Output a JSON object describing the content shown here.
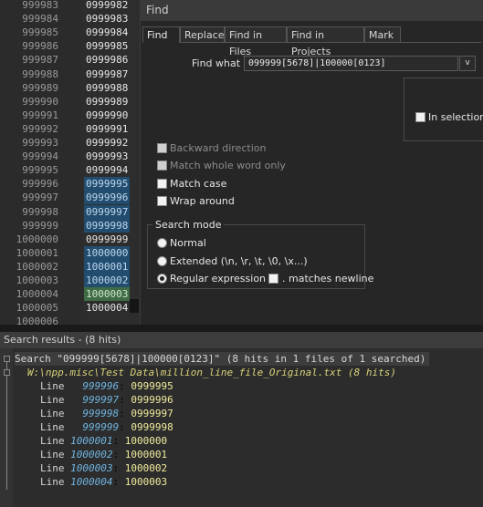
{
  "editor": {
    "line_numbers": [
      "999983",
      "999984",
      "999985",
      "999986",
      "999987",
      "999988",
      "999989",
      "999990",
      "999991",
      "999992",
      "999993",
      "999994",
      "999995",
      "999996",
      "999997",
      "999998",
      "999999",
      "1000000",
      "1000001",
      "1000002",
      "1000003",
      "1000004",
      "1000005",
      "1000006"
    ],
    "line_texts": [
      "0999982",
      "0999983",
      "0999984",
      "0999985",
      "0999986",
      "0999987",
      "0999988",
      "0999989",
      "0999990",
      "0999991",
      "0999992",
      "0999993",
      "0999994",
      "0999995",
      "0999996",
      "0999997",
      "0999998",
      "0999999",
      "1000000",
      "1000001",
      "1000002",
      "1000003",
      "1000004",
      ""
    ]
  },
  "find_dialog": {
    "title": "Find",
    "tabs": [
      "Find",
      "Replace",
      "Find in Files",
      "Find in Projects",
      "Mark"
    ],
    "active_tab": "Find",
    "find_what_label": "Find what :",
    "find_what_value": "099999[5678]|100000[0123]",
    "dropdown_glyph": "v",
    "in_selection_label": "In selection",
    "options": {
      "backward_direction": "Backward direction",
      "match_whole_word": "Match whole word only",
      "match_case": "Match case",
      "wrap_around": "Wrap around"
    },
    "search_mode": {
      "legend": "Search mode",
      "normal": "Normal",
      "extended": "Extended (\\n, \\r, \\t, \\0, \\x...)",
      "regex": "Regular expression",
      "matches_newline": ". matches newline",
      "selected": "regex"
    }
  },
  "results": {
    "header": "Search results - (8 hits)",
    "search_line": "Search \"099999[5678]|100000[0123]\" (8 hits in 1 files of 1 searched)",
    "file_line": "W:\\npp.misc\\Test Data\\million_line_file_Original.txt (8 hits)",
    "hits": [
      {
        "kw": "Line",
        "num": "  999996",
        "val": "0999995"
      },
      {
        "kw": "Line",
        "num": "  999997",
        "val": "0999996"
      },
      {
        "kw": "Line",
        "num": "  999998",
        "val": "0999997"
      },
      {
        "kw": "Line",
        "num": "  999999",
        "val": "0999998"
      },
      {
        "kw": "Line",
        "num": "1000001",
        "val": "1000000"
      },
      {
        "kw": "Line",
        "num": "1000002",
        "val": "1000001"
      },
      {
        "kw": "Line",
        "num": "1000003",
        "val": "1000002"
      },
      {
        "kw": "Line",
        "num": "1000004",
        "val": "1000003"
      }
    ]
  },
  "colors": {
    "hit_highlight": "#234d6e",
    "current_line": "#3f6b45",
    "line_ref": "#6fb3e0",
    "match_text": "#f0ec9c",
    "file_path": "#d9d27a"
  }
}
